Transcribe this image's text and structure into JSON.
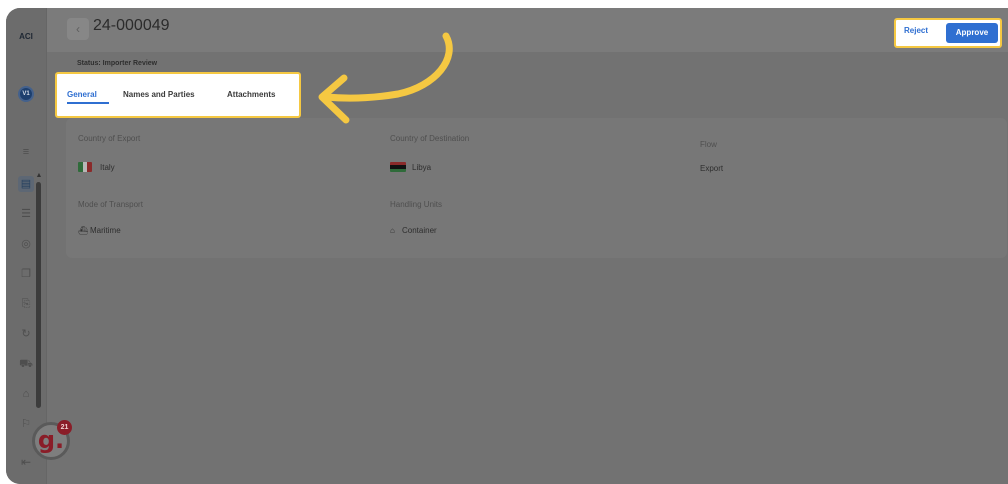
{
  "sidebar": {
    "logo": "ACI",
    "avatar": "V1",
    "items": [
      {
        "name": "sliders-icon",
        "glyph": "≡"
      },
      {
        "name": "document-icon",
        "glyph": "▤",
        "active": true
      },
      {
        "name": "list-icon",
        "glyph": "☰"
      },
      {
        "name": "globe-icon",
        "glyph": "◎"
      },
      {
        "name": "copy-icon",
        "glyph": "❐"
      },
      {
        "name": "file-icon",
        "glyph": "⎘"
      },
      {
        "name": "refresh-icon",
        "glyph": "↻"
      },
      {
        "name": "truck-icon",
        "glyph": "⛟"
      },
      {
        "name": "bank-icon",
        "glyph": "⌂"
      },
      {
        "name": "flag-icon",
        "glyph": "⚐"
      }
    ],
    "exit_icon": "exit-icon",
    "badge": {
      "letter": "g.",
      "count": "21"
    }
  },
  "header": {
    "back_icon": "‹",
    "ticket_id": "24-000049",
    "reject_label": "Reject",
    "approve_label": "Approve"
  },
  "status": "Status: Importer Review",
  "tabs": [
    {
      "label": "General",
      "active": true
    },
    {
      "label": "Names and Parties"
    },
    {
      "label": "Attachments"
    }
  ],
  "details": {
    "country_of_export_label": "Country of Export",
    "country_of_export_value": "Italy",
    "country_of_destination_label": "Country of Destination",
    "country_of_destination_value": "Libya",
    "flow_label": "Flow",
    "flow_value": "Export",
    "mode_of_transport_label": "Mode of Transport",
    "mode_of_transport_value": "Maritime",
    "handling_units_label": "Handling Units",
    "handling_units_value": "Container"
  },
  "colors": {
    "accent": "#2f6fd1",
    "highlight": "#f5c842"
  }
}
